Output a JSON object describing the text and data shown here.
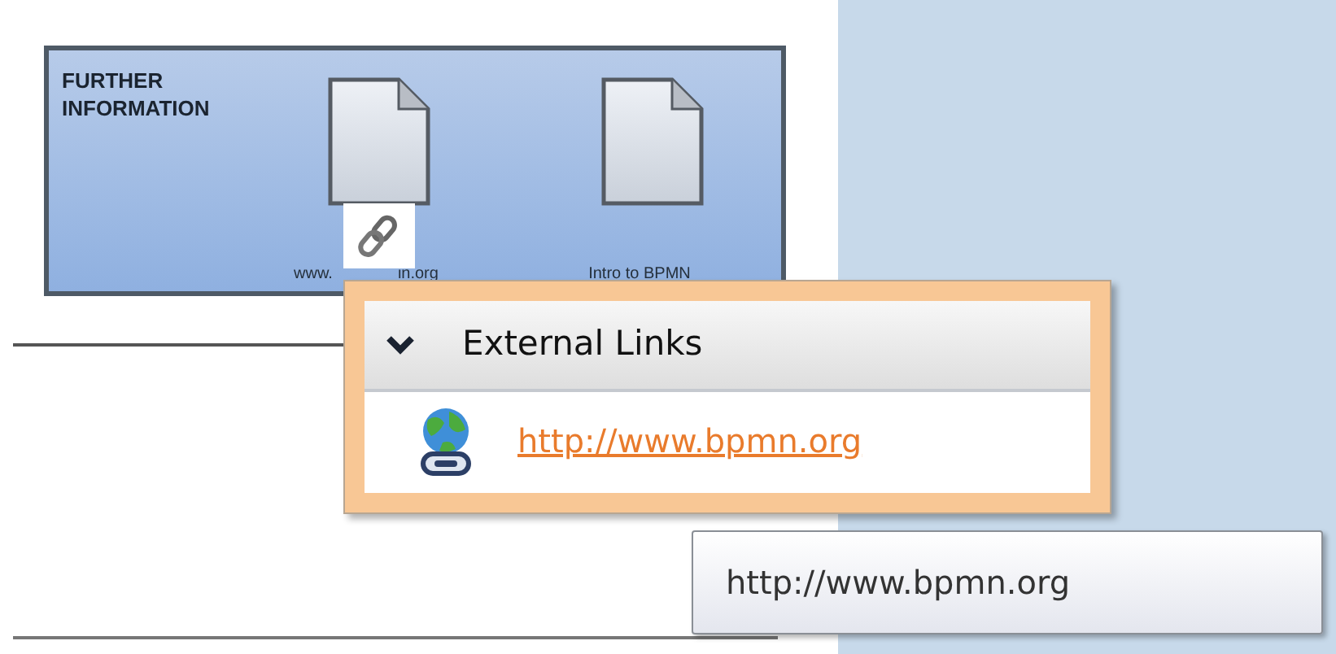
{
  "group": {
    "title": "FURTHER INFORMATION",
    "documents": [
      {
        "label_parts": [
          "www.",
          "in.org"
        ],
        "linked": true
      },
      {
        "label_parts": [
          "Intro to BPMN"
        ],
        "linked": false
      }
    ]
  },
  "popup": {
    "section": {
      "title": "External Links",
      "expanded": true
    },
    "links": [
      {
        "url": "http://www.bpmn.org"
      }
    ]
  },
  "tooltip": {
    "text": "http://www.bpmn.org"
  }
}
